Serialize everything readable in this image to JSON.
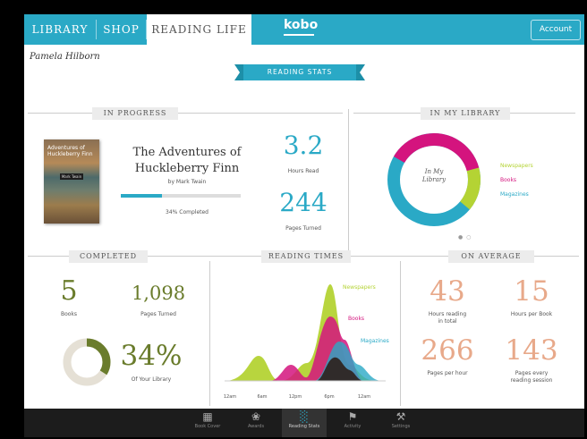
{
  "nav": {
    "tabs": [
      {
        "label": "LIBRARY"
      },
      {
        "label": "SHOP"
      },
      {
        "label": "READING LIFE"
      }
    ],
    "logo": "kobo",
    "account_label": "Account"
  },
  "user": {
    "name": "Pamela Hilborn"
  },
  "banner": {
    "label": "READING STATS"
  },
  "in_progress": {
    "section_title": "IN PROGRESS",
    "cover_title": "Adventures of Huckleberry Finn",
    "cover_author": "Mark Twain",
    "book_title_line1": "The Adventures of",
    "book_title_line2": "Huckleberry Finn",
    "book_author": "by Mark Twain",
    "progress_fraction": 0.34,
    "completed_text": "34% Completed",
    "hours_read": "3.2",
    "hours_read_label": "Hours Read",
    "pages_turned": "244",
    "pages_turned_label": "Pages Turned"
  },
  "in_library": {
    "section_title": "IN MY LIBRARY",
    "center_label_line1": "In My",
    "center_label_line2": "Library",
    "legend": [
      {
        "label": "Newspapers",
        "color": "#b4d334"
      },
      {
        "label": "Books",
        "color": "#d4147e"
      },
      {
        "label": "Magazines",
        "color": "#2aa9c6"
      }
    ],
    "page_dots": "● ○"
  },
  "completed": {
    "section_title": "COMPLETED",
    "books": "5",
    "books_label": "Books",
    "pages_turned": "1,098",
    "pages_turned_label": "Pages Turned",
    "library_percent": "34%",
    "library_fraction": 0.34,
    "library_label": "Of Your Library"
  },
  "reading_times": {
    "section_title": "READING TIMES",
    "labels": [
      {
        "label": "Newspapers",
        "color": "#b4d334"
      },
      {
        "label": "Books",
        "color": "#d4147e"
      },
      {
        "label": "Magazines",
        "color": "#2aa9c6"
      }
    ],
    "x_ticks": [
      "12am",
      "6am",
      "12pm",
      "6pm",
      "12am"
    ]
  },
  "on_average": {
    "section_title": "ON AVERAGE",
    "stats": [
      {
        "value": "43",
        "label_line1": "Hours reading",
        "label_line2": "in total"
      },
      {
        "value": "15",
        "label_line1": "Hours per Book",
        "label_line2": ""
      },
      {
        "value": "266",
        "label_line1": "Pages per hour",
        "label_line2": ""
      },
      {
        "value": "143",
        "label_line1": "Pages every",
        "label_line2": "reading session"
      }
    ],
    "color": "#e8a98a"
  },
  "bottom_nav": [
    {
      "label": "Book Cover",
      "icon": "book-cover-icon"
    },
    {
      "label": "Awards",
      "icon": "awards-icon"
    },
    {
      "label": "Reading Stats",
      "icon": "reading-stats-icon"
    },
    {
      "label": "Activity",
      "icon": "activity-icon"
    },
    {
      "label": "Settings",
      "icon": "settings-icon"
    }
  ]
}
